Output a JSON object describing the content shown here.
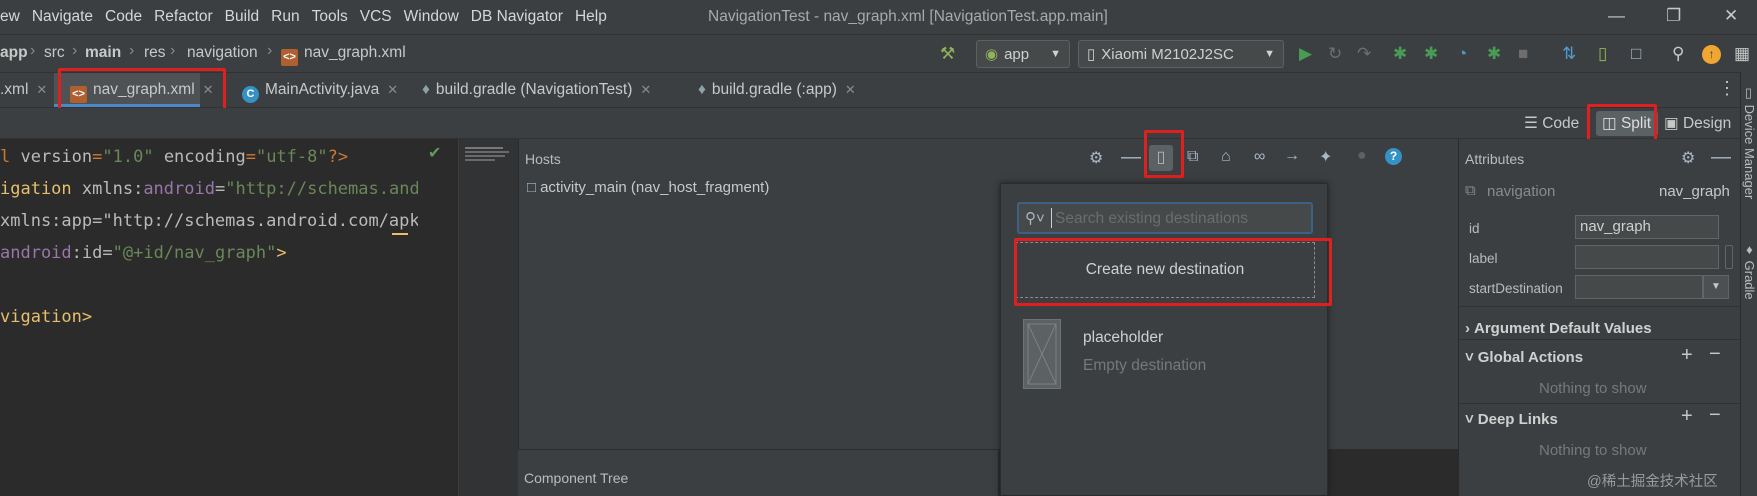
{
  "menu": [
    "ew",
    "Navigate",
    "Code",
    "Refactor",
    "Build",
    "Run",
    "Tools",
    "VCS",
    "Window",
    "DB Navigator",
    "Help"
  ],
  "window_title": "NavigationTest - nav_graph.xml [NavigationTest.app.main]",
  "breadcrumb": [
    "app",
    "src",
    "main",
    "res",
    "navigation",
    "nav_graph.xml"
  ],
  "run_config": "app",
  "device": "Xiaomi M2102J2SC",
  "tabs": [
    {
      "label": ".xml"
    },
    {
      "label": "nav_graph.xml",
      "active": true
    },
    {
      "label": "MainActivity.java"
    },
    {
      "label": "build.gradle (NavigationTest)"
    },
    {
      "label": "build.gradle (:app)"
    }
  ],
  "view_modes": {
    "code": "Code",
    "split": "Split",
    "design": "Design",
    "active": "Split"
  },
  "code_lines": [
    {
      "a": "l ",
      "b": "version",
      "c": "=",
      "d": "\"1.0\"",
      "e": " encoding",
      "f": "=",
      "g": "\"utf-8\"",
      "h": "?>"
    },
    {
      "tag": "igation",
      "ns": " xmlns:",
      "attr": "android",
      "eq": "=",
      "val": "\"http://schemas.andr"
    },
    {
      "text": "xmlns:app=\"http://schemas.android.com/apk/"
    },
    {
      "ns": "android",
      "attr": ":id",
      "eq": "=",
      "val": "\"@+id/nav_graph\"",
      "end": ">"
    },
    {
      "text": ""
    },
    {
      "tag": "vigation>"
    }
  ],
  "hosts": {
    "title": "Hosts",
    "item": "activity_main (nav_host_fragment)"
  },
  "component_tree": "Component Tree",
  "popup": {
    "search_placeholder": "Search existing destinations",
    "create_label": "Create new destination",
    "placeholder_title": "placeholder",
    "placeholder_subtitle": "Empty destination"
  },
  "attributes": {
    "title": "Attributes",
    "type": "navigation",
    "name": "nav_graph",
    "id_label": "id",
    "id_value": "nav_graph",
    "label_label": "label",
    "label_value": "",
    "start_label": "startDestination",
    "start_value": "",
    "sections": [
      {
        "title": "Argument Default Values"
      },
      {
        "title": "Global Actions",
        "empty": "Nothing to show"
      },
      {
        "title": "Deep Links",
        "empty": "Nothing to show"
      }
    ]
  },
  "sidebar": {
    "device_manager": "Device Manager",
    "gradle": "Gradle"
  },
  "watermark": "@稀土掘金技术社区",
  "colors": {
    "highlight_red": "#e0201f",
    "accent_blue": "#3d6185",
    "run_green": "#499c54"
  }
}
